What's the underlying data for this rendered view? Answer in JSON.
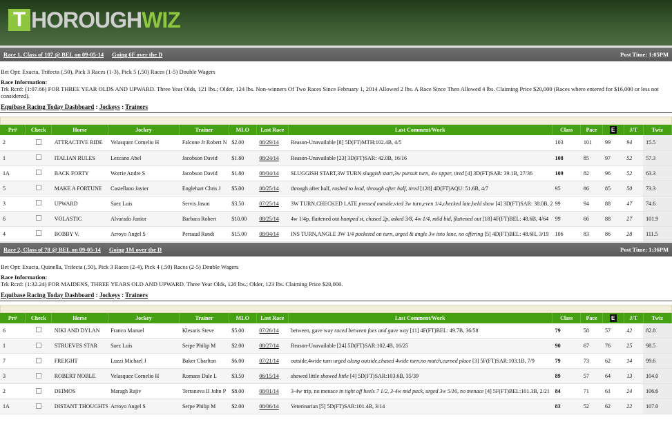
{
  "brand": {
    "logo_t": "T",
    "logo_a": "HOROUGH",
    "logo_b": "WIZ"
  },
  "columns": [
    "Pr#",
    "Check",
    "Horse",
    "Jockey",
    "Trainer",
    "MLO",
    "Last Race",
    "Last Comment/Work",
    "Class",
    "Pace",
    "E",
    "J/T",
    "Twiz"
  ],
  "links": {
    "dashboard": "Equibase Racing Today Dashboard",
    "sep": ":",
    "jockeys": "Jockeys",
    "trainers": "Trainers"
  },
  "races": [
    {
      "title": "Race 1, Class of 107 @ BEL on 09-05-14",
      "going": "Going 6F over the D",
      "post_time": "Post Time: 1:05PM",
      "bet_options": "Bet Opt: Exacta, Trifecta (.50), Pick 3 Races (1-3), Pick 5 (.50) Races (1-5) Double Wagers",
      "info_label": "Race Information:",
      "info_text": "Trk Rcrd: (1:07.66) FOR THREE YEAR OLDS AND UPWARD. Three Year Olds, 121 lbs.; Older, 124 lbs. Non-winners Of Two Races Since February 1, 2014 Allowed 2 lbs. A Race Since Then Allowed 4 lbs. Claiming Price $20,000 (Races where entered for $16,000 or less not considered).",
      "rows": [
        {
          "pr": "2",
          "horse": "ATTRACTIVE RIDE",
          "jockey": "Velasquez Cornelio H",
          "trainer": "Falcone Jr Robert N",
          "mlo": "$2.00",
          "last_race": "08/29/14",
          "comment": "Reason-Unavailable",
          "comment_italic": "",
          "work": "[8] 5D(FT)MTH:102.4B, 4/5",
          "class": "103",
          "class_bold": false,
          "pace": "101",
          "e": "99",
          "jt": "94",
          "twiz": "15.5"
        },
        {
          "pr": "1",
          "horse": "ITALIAN RULES",
          "jockey": "Lezcano Abel",
          "trainer": "Jacobson David",
          "mlo": "$1.80",
          "last_race": "08/24/14",
          "comment": "Reason-Unavailable",
          "comment_italic": "",
          "work": "[23] 3D(FT)SAR: 42.0B, 16/16",
          "class": "108",
          "class_bold": true,
          "pace": "85",
          "e": "97",
          "jt": "52",
          "twiz": "57.3"
        },
        {
          "pr": "1A",
          "horse": "BACK FORTY",
          "jockey": "Worrie Andre S",
          "trainer": "Jacobson David",
          "mlo": "$1.80",
          "last_race": "08/04/14",
          "comment": "SLUGGISH START,3W TURN",
          "comment_italic": "sluggish start,3w pursuit turn, 4w upper, tired",
          "work": "[4] 3D(FT)SAR: 39.1B, 27/36",
          "class": "109",
          "class_bold": true,
          "pace": "82",
          "e": "96",
          "jt": "52",
          "twiz": "63.3"
        },
        {
          "pr": "5",
          "horse": "MAKE A FORTUNE",
          "jockey": "Castellano Javier",
          "trainer": "Englehart Chris J",
          "mlo": "$5.00",
          "last_race": "08/25/14",
          "comment": "through after half,",
          "comment_italic": "rushed to lead, through after half, tired",
          "work": "[128] 4D(FT)AQU: 51.6B, 4/7",
          "class": "95",
          "class_bold": false,
          "pace": "86",
          "e": "85",
          "jt": "50",
          "twiz": "73.3"
        },
        {
          "pr": "3",
          "horse": "UPWARD",
          "jockey": "Saez Luis",
          "trainer": "Servis Jason",
          "mlo": "$3.50",
          "last_race": "07/25/14",
          "comment": "3W TURN,CHECKED LATE",
          "comment_italic": "pressed outside,vied 3w turn,even 1/4,checked late,held show",
          "work": "[4] 3D(FT)SAR: 38.0B, 23/36",
          "class": "99",
          "class_bold": false,
          "pace": "94",
          "e": "88",
          "jt": "47",
          "twiz": "74.6"
        },
        {
          "pr": "6",
          "horse": "VOLASTIC",
          "jockey": "Alvarado Junior",
          "trainer": "Barbara Robert",
          "mlo": "$10.00",
          "last_race": "08/25/14",
          "comment": "4w 1/4p, flattened out",
          "comment_italic": "bumped st, chased 2p, asked 3/8, 4w 1/4, mild bid, flattened out",
          "work": "[18] 4F(FT)BEL: 48.6B, 4/64",
          "class": "99",
          "class_bold": false,
          "pace": "66",
          "e": "88",
          "jt": "27",
          "twiz": "101.9"
        },
        {
          "pr": "4",
          "horse": "BOBBY V.",
          "jockey": "Arroyo Angel S",
          "trainer": "Persaud Randi",
          "mlo": "$15.00",
          "last_race": "08/04/14",
          "comment": "INS TURN,ANGLE 3W 1/4",
          "comment_italic": "pocketed on turn, urged & angle 3w into lane, no offering",
          "work": "[5] 4D(FT)BEL: 48.6H, 3/19",
          "class": "106",
          "class_bold": false,
          "pace": "83",
          "e": "86",
          "jt": "28",
          "twiz": "111.5"
        }
      ]
    },
    {
      "title": "Race 2, Class of 78 @ BEL on 09-05-14",
      "going": "Going 1M over the D",
      "post_time": "Post Time: 1:36PM",
      "bet_options": "Bet Opt: Exacta, Quinella, Trifecta (.50), Pick 3 Races (2-4), Pick 4 (.50) Races (2-5) Double Wagers",
      "info_label": "Race Information:",
      "info_text": "Trk Rcrd: (1:32.24) FOR MAIDENS, THREE YEARS OLD AND UPWARD. Three Year Olds, 120 lbs.; Older, 123 lbs. Claiming Price $20,000.",
      "rows": [
        {
          "pr": "6",
          "horse": "NIKI AND DYLAN",
          "jockey": "Franco Manuel",
          "trainer": "Klesaris Steve",
          "mlo": "$5.00",
          "last_race": "07/26/14",
          "comment": "between, gave way",
          "comment_italic": "raced between foes and gave way",
          "work": "[11] 4F(FT)BEL: 49.7B, 36/58",
          "class": "79",
          "class_bold": true,
          "pace": "58",
          "e": "57",
          "jt": "42",
          "twiz": "82.8"
        },
        {
          "pr": "1",
          "horse": "STRUEVES STAR",
          "jockey": "Saez Luis",
          "trainer": "Serpe Philip M",
          "mlo": "$2.00",
          "last_race": "08/27/14",
          "comment": "Reason-Unavailable",
          "comment_italic": "",
          "work": "[24] 5D(FT)SAR:102.4B, 16/25",
          "class": "90",
          "class_bold": true,
          "pace": "67",
          "e": "76",
          "jt": "25",
          "twiz": "98.5"
        },
        {
          "pr": "7",
          "horse": "FREIGHT",
          "jockey": "Luzzi Michael J",
          "trainer": "Baker Charlton",
          "mlo": "$6.00",
          "last_race": "07/21/14",
          "comment": "outside,4wide turn",
          "comment_italic": "urged along outside,chased 4wide turn,no match,earned place",
          "work": "[3] 5F(FT)SAR:103.1B, 7/9",
          "class": "79",
          "class_bold": true,
          "pace": "73",
          "e": "62",
          "jt": "14",
          "twiz": "99.6"
        },
        {
          "pr": "3",
          "horse": "ROBERT NOBLE",
          "jockey": "Velasquez Cornelio H",
          "trainer": "Romans Dale L",
          "mlo": "$3.50",
          "last_race": "06/15/14",
          "comment": "showed little",
          "comment_italic": "showed little",
          "work": "[4] 5D(FT)SAR:103.6B, 35/39",
          "class": "89",
          "class_bold": true,
          "pace": "57",
          "e": "64",
          "jt": "13",
          "twiz": "104.0"
        },
        {
          "pr": "2",
          "horse": "DEIMOS",
          "jockey": "Maragh Rajiv",
          "trainer": "Terranova II John P",
          "mlo": "$8.00",
          "last_race": "08/01/14",
          "comment": "3-4w trip, no menace",
          "comment_italic": "in tight off heels 7 1/2, 3-4w mid pack, urged 3w 5/16, no menace",
          "work": "[4] 5F(FT)BEL:101.3B, 2/21",
          "class": "84",
          "class_bold": true,
          "pace": "71",
          "e": "61",
          "jt": "24",
          "twiz": "106.6"
        },
        {
          "pr": "1A",
          "horse": "DISTANT THOUGHTS",
          "jockey": "Arroyo Angel S",
          "trainer": "Serpe Philip M",
          "mlo": "$2.00",
          "last_race": "08/06/14",
          "comment": "Veterinarian",
          "comment_italic": "",
          "work": "[5] 5D(FT)SAR:101.4B, 3/14",
          "class": "83",
          "class_bold": true,
          "pace": "52",
          "e": "62",
          "jt": "22",
          "twiz": "107.0"
        }
      ]
    }
  ]
}
